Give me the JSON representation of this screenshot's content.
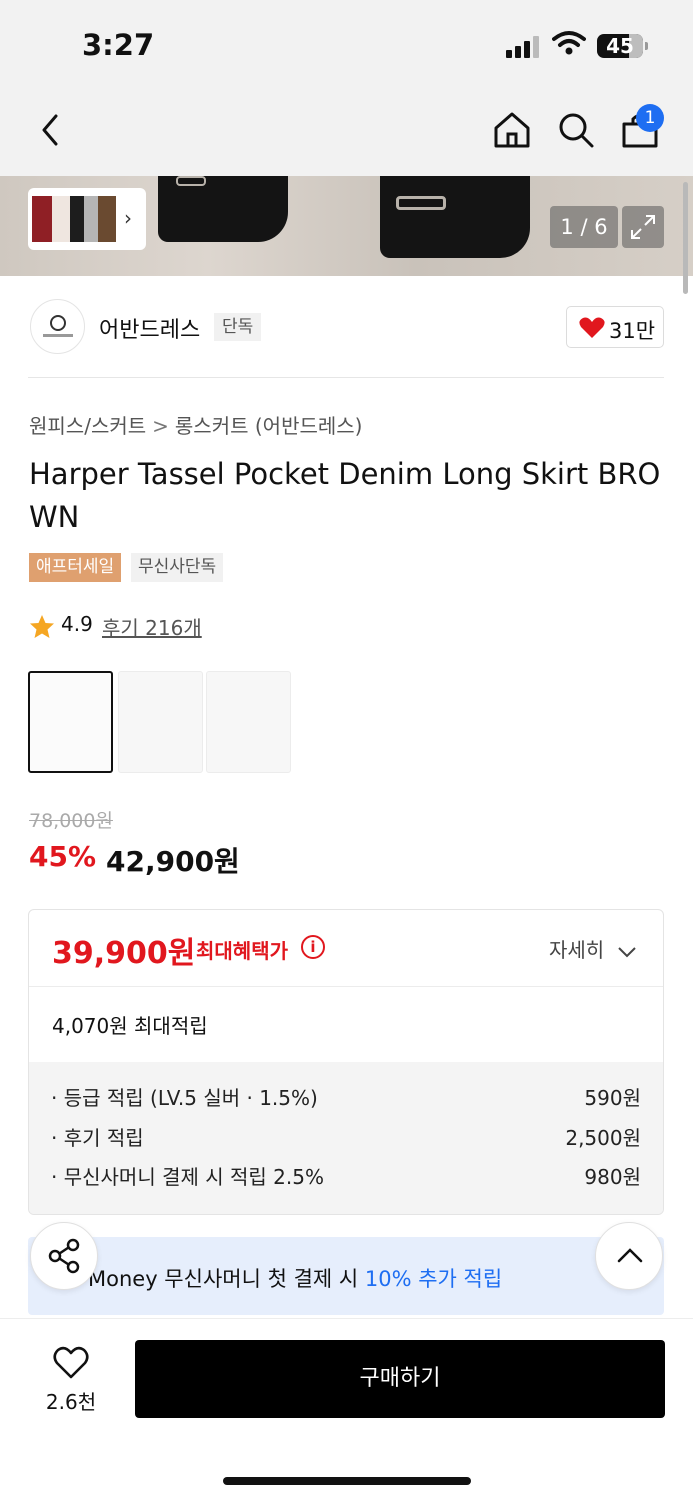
{
  "status_bar": {
    "time": "3:27",
    "battery": "45"
  },
  "nav": {
    "cart_count": "1"
  },
  "gallery": {
    "counter": "1 / 6"
  },
  "brand": {
    "name": "어반드레스",
    "tag": "단독",
    "likes": "31만"
  },
  "breadcrumb": {
    "category": "원피스/스커트",
    "separator": ">",
    "subcategory": "롱스커트 (어반드레스)"
  },
  "product": {
    "title": "Harper Tassel Pocket Denim Long Skirt BROWN",
    "badges": [
      "애프터세일",
      "무신사단독"
    ],
    "rating": "4.9",
    "reviews": "후기 216개"
  },
  "price": {
    "original": "78,000원",
    "discount": "45%",
    "sale": "42,900원"
  },
  "benefit": {
    "max_price": "39,900원",
    "max_label": "최대혜택가",
    "detail": "자세히",
    "points_total": "4,070원 최대적립",
    "rows": [
      {
        "label": "· 등급 적립 (LV.5 실버 · 1.5%)",
        "value": "590원"
      },
      {
        "label": "· 후기 적립",
        "value": "2,500원"
      },
      {
        "label": "· 무신사머니 결제 시 적립 2.5%",
        "value": "980원"
      }
    ]
  },
  "money_banner": {
    "prefix": "Money 무신사머니 첫 결제 시 ",
    "highlight": "10% 추가 적립"
  },
  "bottom": {
    "wish_count": "2.6천",
    "buy_label": "구매하기"
  },
  "colors": {
    "accent_red": "#e1171e",
    "accent_blue": "#1e6ef2",
    "sale_badge": "#dfa06f"
  }
}
